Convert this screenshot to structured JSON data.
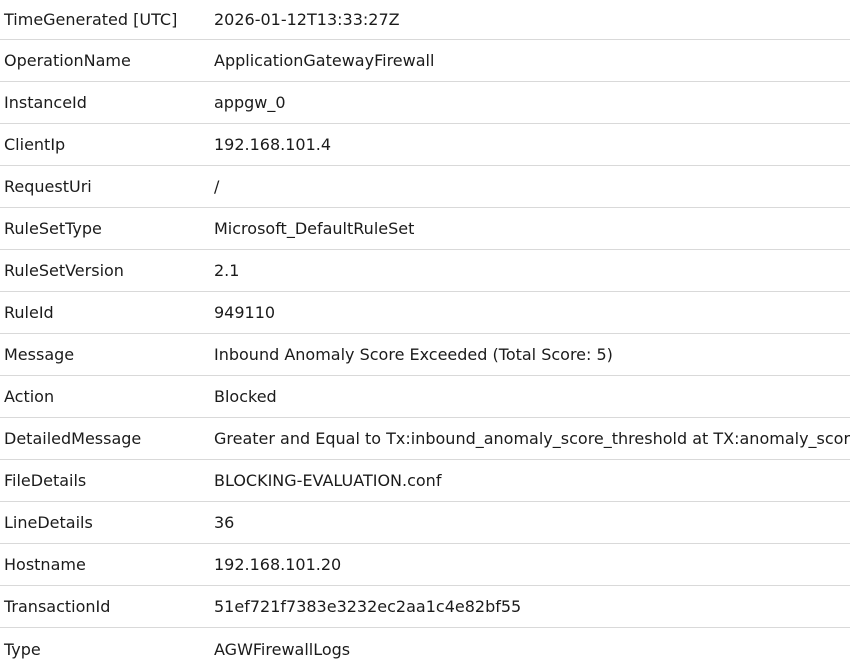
{
  "rows": [
    {
      "field": "TimeGenerated [UTC]",
      "value": "2026-01-12T13:33:27Z"
    },
    {
      "field": "OperationName",
      "value": "ApplicationGatewayFirewall"
    },
    {
      "field": "InstanceId",
      "value": "appgw_0"
    },
    {
      "field": "ClientIp",
      "value": "192.168.101.4"
    },
    {
      "field": "RequestUri",
      "value": "/"
    },
    {
      "field": "RuleSetType",
      "value": "Microsoft_DefaultRuleSet"
    },
    {
      "field": "RuleSetVersion",
      "value": "2.1"
    },
    {
      "field": "RuleId",
      "value": "949110"
    },
    {
      "field": "Message",
      "value": "Inbound Anomaly Score Exceeded (Total Score: 5)"
    },
    {
      "field": "Action",
      "value": "Blocked"
    },
    {
      "field": "DetailedMessage",
      "value": "Greater and Equal to Tx:inbound_anomaly_score_threshold at TX:anomaly_score."
    },
    {
      "field": "FileDetails",
      "value": "BLOCKING-EVALUATION.conf"
    },
    {
      "field": "LineDetails",
      "value": "36"
    },
    {
      "field": "Hostname",
      "value": "192.168.101.20"
    },
    {
      "field": "TransactionId",
      "value": "51ef721f7383e3232ec2aa1c4e82bf55"
    },
    {
      "field": "Type",
      "value": "AGWFirewallLogs"
    }
  ]
}
